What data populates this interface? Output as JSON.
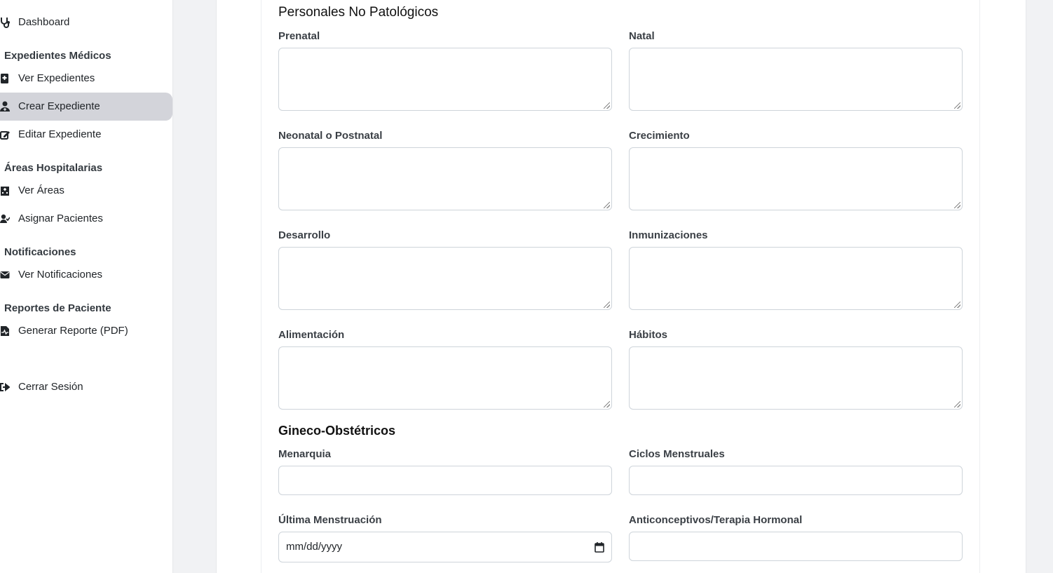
{
  "sidebar": {
    "items": [
      {
        "label": "Dashboard",
        "icon": "stethoscope-icon"
      },
      {
        "label": "Ver Expedientes",
        "icon": "file-medical-icon"
      },
      {
        "label": "Crear Expediente",
        "icon": "user-doctor-icon"
      },
      {
        "label": "Editar Expediente",
        "icon": "pen-to-square-icon"
      },
      {
        "label": "Ver Áreas",
        "icon": "hospital-icon"
      },
      {
        "label": "Asignar Pacientes",
        "icon": "user-check-icon"
      },
      {
        "label": "Ver Notificaciones",
        "icon": "envelope-icon"
      },
      {
        "label": "Generar Reporte (PDF)",
        "icon": "file-waveform-icon"
      },
      {
        "label": "Cerrar Sesión",
        "icon": "sign-out-icon"
      }
    ],
    "sections": [
      "Expedientes Médicos",
      "Áreas Hospitalarias",
      "Notificaciones",
      "Reportes de Paciente"
    ],
    "active_color": "#d3d4da"
  },
  "form": {
    "personales_title": "Personales No Patológicos",
    "gineco_title": "Gineco-Obstétricos",
    "fields": {
      "prenatal": "Prenatal",
      "natal": "Natal",
      "neonatal": "Neonatal o Postnatal",
      "crecimiento": "Crecimiento",
      "desarrollo": "Desarrollo",
      "inmunizaciones": "Inmunizaciones",
      "alimentacion": "Alimentación",
      "habitos": "Hábitos",
      "menarquia": "Menarquia",
      "ciclos": "Ciclos Menstruales",
      "ultima": "Última Menstruación",
      "anticonceptivos": "Anticonceptivos/Terapia Hormonal"
    },
    "date_placeholder": "mm/dd/yyyy"
  }
}
